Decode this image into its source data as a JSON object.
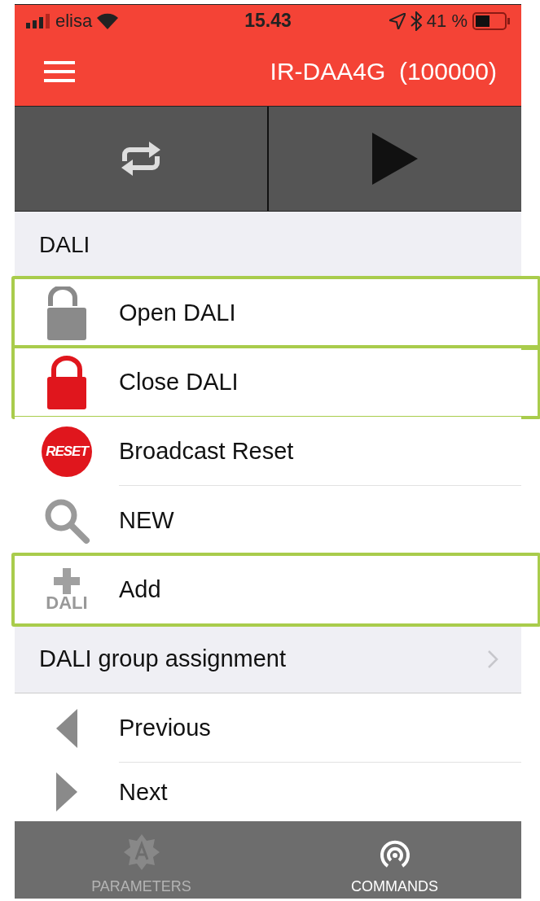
{
  "status_bar": {
    "carrier": "elisa",
    "time": "15.43",
    "battery": "41 %"
  },
  "header": {
    "title": "IR-DAA4G  (100000)"
  },
  "toolbar": [
    {
      "kind": "repeat"
    },
    {
      "kind": "play"
    }
  ],
  "section": {
    "title": "DALI"
  },
  "commands": [
    {
      "kind": "lock-open",
      "label": "Open DALI",
      "highlighted": true
    },
    {
      "kind": "lock-closed",
      "label": "Close DALI",
      "highlighted": true
    },
    {
      "kind": "reset",
      "label": "Broadcast Reset",
      "icon_text": "RESET",
      "highlighted": false
    },
    {
      "kind": "search",
      "label": "NEW",
      "highlighted": false
    },
    {
      "kind": "add",
      "label": "Add",
      "icon_text": "DALI",
      "highlighted": true
    }
  ],
  "group_row": {
    "label": "DALI group assignment"
  },
  "nav": [
    {
      "kind": "previous",
      "label": "Previous"
    },
    {
      "kind": "next",
      "label": "Next"
    }
  ],
  "tabs": [
    {
      "kind": "parameters",
      "label": "PARAMETERS",
      "selected": false
    },
    {
      "kind": "commands",
      "label": "COMMANDS",
      "selected": true
    }
  ]
}
